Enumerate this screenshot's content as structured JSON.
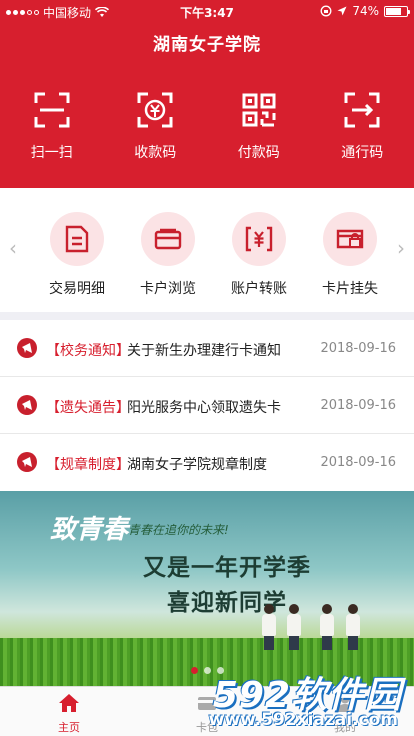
{
  "status_bar": {
    "carrier": "中国移动",
    "time": "下午3:47",
    "battery": "74%",
    "battery_level": 0.74
  },
  "header": {
    "title": "湖南女子学院"
  },
  "top_actions": [
    {
      "label": "扫一扫",
      "icon": "scan-icon"
    },
    {
      "label": "收款码",
      "icon": "receive-code-icon"
    },
    {
      "label": "付款码",
      "icon": "pay-code-icon"
    },
    {
      "label": "通行码",
      "icon": "pass-code-icon"
    }
  ],
  "services": [
    {
      "label": "交易明细",
      "icon": "transaction-details-icon"
    },
    {
      "label": "卡户浏览",
      "icon": "card-browse-icon"
    },
    {
      "label": "账户转账",
      "icon": "account-transfer-icon"
    },
    {
      "label": "卡片挂失",
      "icon": "card-loss-icon"
    }
  ],
  "news": [
    {
      "tag": "【校务通知】",
      "title": "关于新生办理建行卡通知",
      "date": "2018-09-16"
    },
    {
      "tag": "【遗失通告】",
      "title": "阳光服务中心领取遗失卡",
      "date": "2018-09-16"
    },
    {
      "tag": "【规章制度】",
      "title": "湖南女子学院规章制度",
      "date": "2018-09-16"
    }
  ],
  "banner": {
    "heading": "致青春",
    "sub": "青春在追你的未来!",
    "line1": "又是一年开学季",
    "line2": "喜迎新同学"
  },
  "tabbar": [
    {
      "label": "主页",
      "icon": "home-icon",
      "active": true
    },
    {
      "label": "卡包",
      "icon": "card-wallet-icon",
      "active": false
    },
    {
      "label": "我的",
      "icon": "profile-icon",
      "active": false
    }
  ],
  "watermark": {
    "line1": "592软件园",
    "line2": "www.592xiazai.com"
  },
  "colors": {
    "brand_red": "#d71f2e",
    "service_bg": "#fbe3e5"
  }
}
